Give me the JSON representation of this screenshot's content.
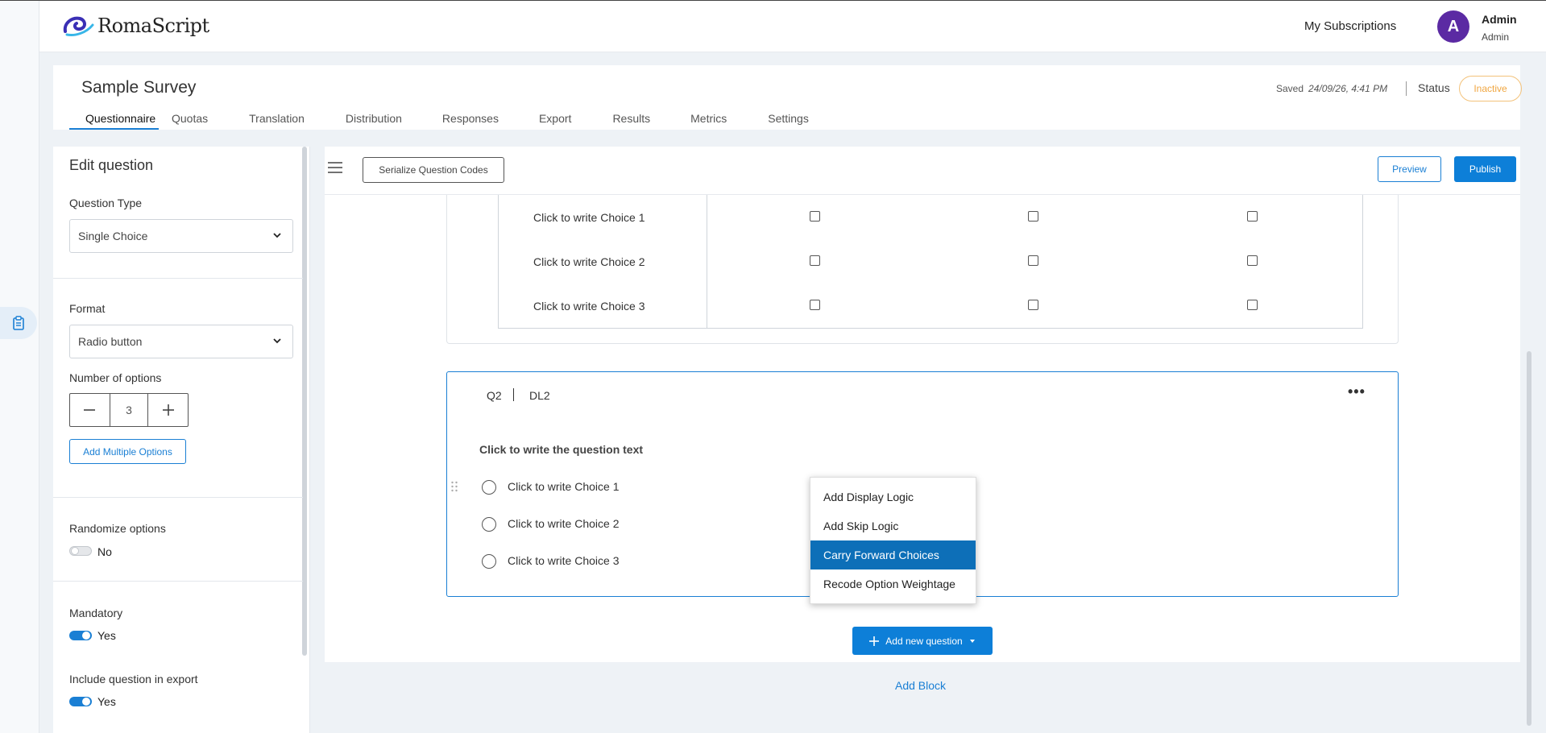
{
  "brand": {
    "name": "RomaScript"
  },
  "header": {
    "subscriptions_label": "My Subscriptions",
    "avatar_letter": "A",
    "user_name": "Admin",
    "user_role": "Admin"
  },
  "survey": {
    "title": "Sample Survey",
    "saved_label": "Saved",
    "saved_time": "24/09/26, 4:41 PM",
    "status_label": "Status",
    "status_value": "Inactive",
    "tabs": [
      {
        "label": "Questionnaire",
        "active": true
      },
      {
        "label": "Quotas"
      },
      {
        "label": "Translation"
      },
      {
        "label": "Distribution"
      },
      {
        "label": "Responses"
      },
      {
        "label": "Export"
      },
      {
        "label": "Results"
      },
      {
        "label": "Metrics"
      },
      {
        "label": "Settings"
      }
    ]
  },
  "edit_panel": {
    "title": "Edit question",
    "question_type_label": "Question Type",
    "question_type_value": "Single Choice",
    "format_label": "Format",
    "format_value": "Radio button",
    "num_options_label": "Number of options",
    "num_options_value": "3",
    "minus": "−",
    "plus": "+",
    "add_multiple_label": "Add Multiple Options",
    "randomize_label": "Randomize options",
    "randomize_value": "No",
    "mandatory_label": "Mandatory",
    "mandatory_value": "Yes",
    "include_export_label": "Include question in export",
    "include_export_value": "Yes"
  },
  "toolbar": {
    "serialize_label": "Serialize Question Codes",
    "preview_label": "Preview",
    "publish_label": "Publish"
  },
  "q1": {
    "rows": [
      "Click to write Choice 1",
      "Click to write Choice 2",
      "Click to write Choice 3"
    ]
  },
  "q2": {
    "id": "Q2",
    "code": "DL2",
    "text": "Click to write the question text",
    "options": [
      "Click to write Choice 1",
      "Click to write Choice 2",
      "Click to write Choice 3"
    ]
  },
  "context_menu": {
    "items": [
      "Add Display Logic",
      "Add Skip Logic",
      "Carry Forward Choices",
      "Recode Option Weightage"
    ]
  },
  "actions": {
    "add_question_label": "Add new question",
    "add_block_label": "Add Block"
  },
  "colors": {
    "accent": "#0d7fd8",
    "status_inactive": "#f0a640",
    "avatar": "#5b2aa3",
    "menu_highlight": "#0d6fb8"
  }
}
